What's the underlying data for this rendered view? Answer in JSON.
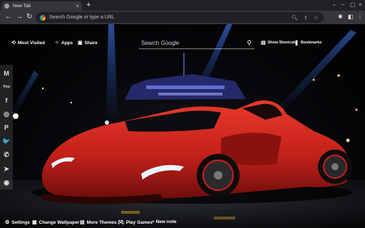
{
  "browser": {
    "tab": {
      "title": "New Tab",
      "close_icon": "close-icon"
    },
    "new_tab_label": "+",
    "omnibox": {
      "placeholder": "Search Google or type a URL"
    }
  },
  "newtab": {
    "top_nav": {
      "most_visited": "Most Visited",
      "apps": "Apps",
      "share": "Share",
      "show_shortcuts": "Show Shortcuts",
      "bookmarks": "Bookmarks"
    },
    "search": {
      "placeholder": "Search Google"
    },
    "social": [
      {
        "name": "gmail-icon",
        "glyph": "M"
      },
      {
        "name": "youtube-icon",
        "glyph": "You"
      },
      {
        "name": "facebook-icon",
        "glyph": "f"
      },
      {
        "name": "instagram-icon",
        "glyph": "◎"
      },
      {
        "name": "pinterest-icon",
        "glyph": "P"
      },
      {
        "name": "twitter-icon",
        "glyph": "🐦"
      },
      {
        "name": "whatsapp-icon",
        "glyph": "✆"
      },
      {
        "name": "telegram-icon",
        "glyph": "➤"
      },
      {
        "name": "reddit-icon",
        "glyph": "◉"
      }
    ],
    "bottom": {
      "settings": "Settings",
      "change_wallpaper": "Change Wallpaper",
      "more_themes": "More Themes",
      "play_games": "Play Games",
      "new_note": "+ New note"
    },
    "colors": {
      "car": "#c61f1a",
      "beam": "#3a6fd8",
      "bg": "#05060a"
    }
  }
}
